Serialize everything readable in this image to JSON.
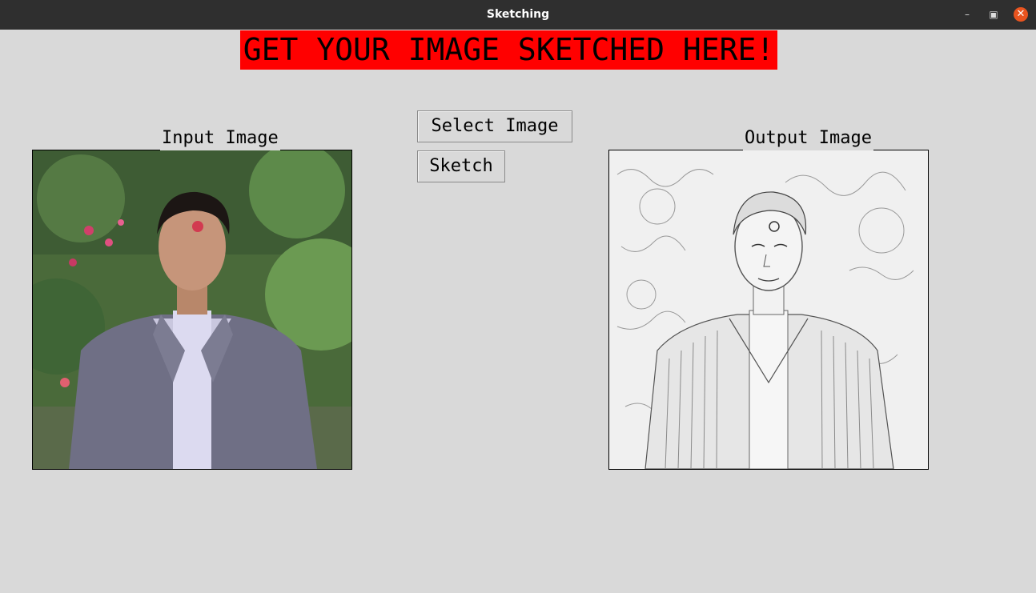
{
  "window": {
    "title": "Sketching",
    "controls": {
      "minimize_icon": "minimize-icon",
      "maximize_icon": "restore-icon",
      "close_icon": "close-icon"
    }
  },
  "banner": {
    "text": "GET YOUR IMAGE SKETCHED HERE!",
    "background": "#ff0000"
  },
  "input_panel": {
    "label": "Input Image"
  },
  "output_panel": {
    "label": "Output Image"
  },
  "buttons": {
    "select_image": "Select Image",
    "sketch": "Sketch"
  },
  "colors": {
    "background": "#d9d9d9",
    "titlebar": "#2f2f2f",
    "close": "#e9541f"
  }
}
